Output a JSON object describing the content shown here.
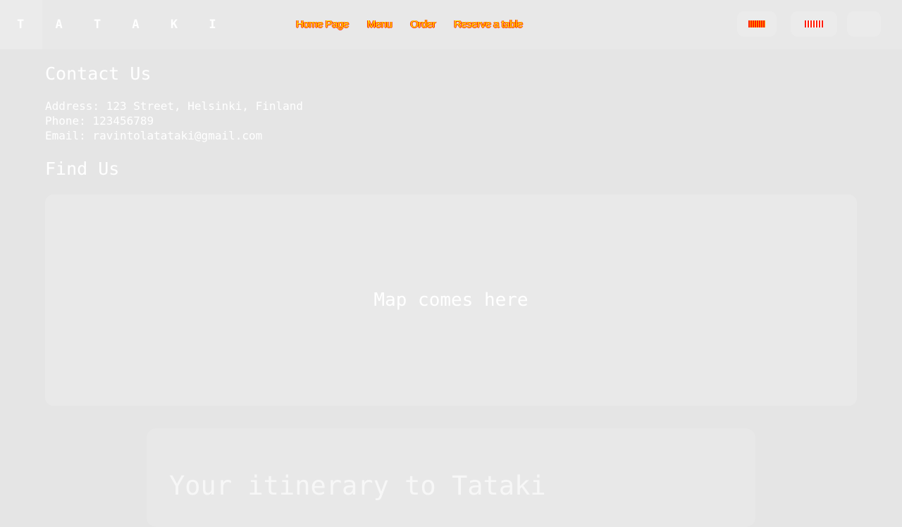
{
  "header": {
    "brand": "T A T A K I",
    "nav": [
      {
        "label": "Home Page"
      },
      {
        "label": "Menu"
      },
      {
        "label": "Order"
      },
      {
        "label": "Reserve a table"
      }
    ],
    "languages": [
      {
        "icon": "gb-flag-icon"
      },
      {
        "icon": "fi-flag-icon"
      },
      {
        "icon": "empty"
      }
    ]
  },
  "contact": {
    "heading": "Contact Us",
    "address": "Address: 123 Street, Helsinki, Finland",
    "phone": "Phone: 123456789",
    "email": "Email: ravintolatataki@gmail.com"
  },
  "find": {
    "heading": "Find Us",
    "map_placeholder": "Map comes here"
  },
  "itinerary": {
    "title": "Your itinerary to Tataki"
  }
}
